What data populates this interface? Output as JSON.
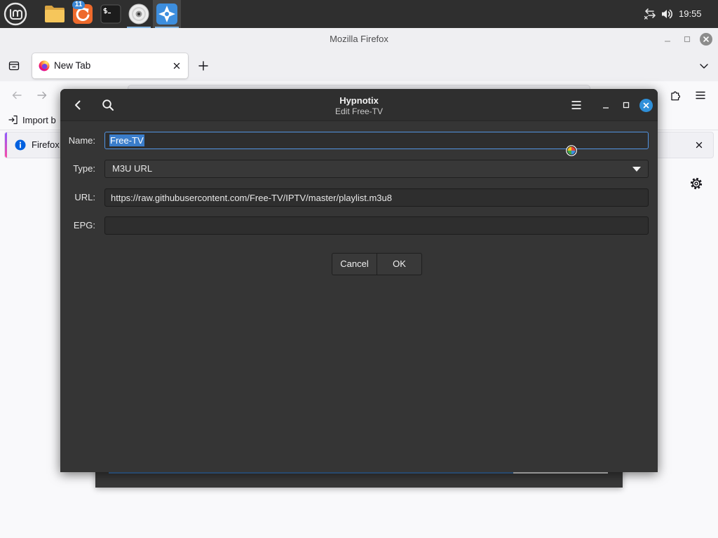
{
  "panel": {
    "menu": {
      "icon": "linux-mint-menu-icon"
    },
    "launchers": {
      "files": {
        "icon": "folder-icon"
      },
      "updates": {
        "icon": "update-manager-icon",
        "badge": "11"
      },
      "terminal": {
        "icon": "terminal-icon"
      },
      "disc": {
        "icon": "disc-icon",
        "running": true
      },
      "hypnotix": {
        "icon": "hypnotix-icon",
        "running": true,
        "focused": true
      }
    },
    "tray": {
      "network_icon": "network-disconnected-icon",
      "volume_icon": "volume-icon",
      "clock": "19:55"
    },
    "colors": {
      "background": "#2f2f2f",
      "running_indicator": "#86b7e4",
      "badge": "#3a87d6"
    }
  },
  "firefox": {
    "window_title": "Mozilla Firefox",
    "tabs": [
      {
        "label": "New Tab",
        "icon": "firefox-logo-icon",
        "active": true
      }
    ],
    "toolbar": {
      "back_icon": "back-arrow-icon",
      "forward_icon": "forward-arrow-icon",
      "extensions_icon": "puzzle-icon",
      "menu_icon": "hamburger-menu-icon"
    },
    "bookmarks": [
      {
        "label": "Import b",
        "icon": "import-icon"
      }
    ],
    "notification": {
      "text": "Firefox",
      "icon": "info-icon"
    },
    "content": {
      "settings_icon": "gear-icon"
    },
    "colors": {
      "chrome": "#efeff2",
      "toolbar": "#f9f9fb",
      "text": "#15141a",
      "info": "#0060df"
    }
  },
  "hypnotix": {
    "title": "Hypnotix",
    "subtitle": "Edit Free-TV",
    "header": {
      "back_icon": "back-chevron-icon",
      "search_icon": "search-icon",
      "menu_icon": "hamburger-menu-icon"
    },
    "form": {
      "name": {
        "label": "Name:",
        "value": "Free-TV",
        "text_selected": true,
        "focused": true
      },
      "type": {
        "label": "Type:",
        "value": "M3U URL"
      },
      "url": {
        "label": "URL:",
        "value": "https://raw.githubusercontent.com/Free-TV/IPTV/master/playlist.m3u8"
      },
      "epg": {
        "label": "EPG:",
        "value": ""
      }
    },
    "buttons": {
      "cancel": "Cancel",
      "ok": "OK"
    },
    "colors": {
      "header": "#2f2f2f",
      "body": "#353535",
      "focus": "#5294e2",
      "selection": "#3a7dcb",
      "close_button": "#2f90d9"
    }
  },
  "cursor": {
    "icon": "busy-cursor-icon"
  },
  "background_window": {
    "progress_fraction": 0.81
  }
}
